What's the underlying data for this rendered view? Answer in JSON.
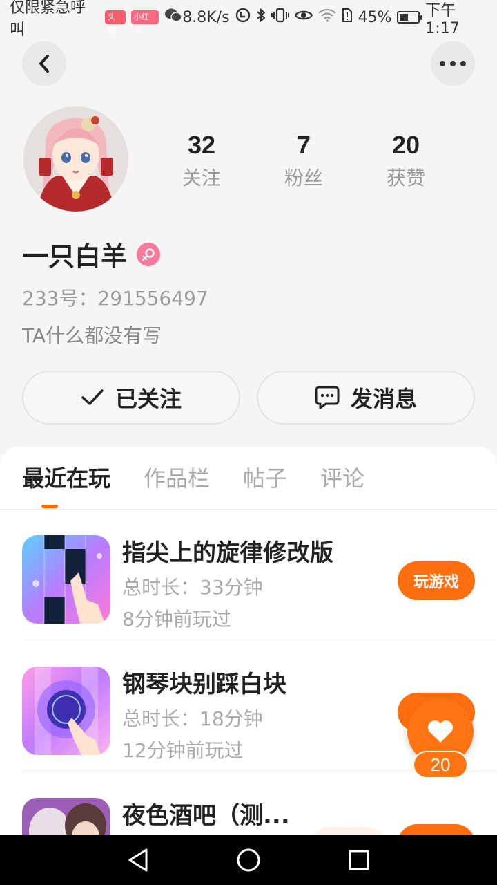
{
  "status_bar": {
    "left_text": "仅限紧急呼叫",
    "badge1": "头条",
    "badge2": "小红书",
    "speed": "8.8K/s",
    "battery": "45%",
    "battery_level": 0.45,
    "time": "下午1:17"
  },
  "profile": {
    "name": "一只白羊",
    "uid": "233号：291556497",
    "bio": "TA什么都没有写",
    "stats": [
      {
        "value": "32",
        "label": "关注"
      },
      {
        "value": "7",
        "label": "粉丝"
      },
      {
        "value": "20",
        "label": "获赞"
      }
    ]
  },
  "actions": {
    "follow_label": "已关注",
    "message_label": "发消息"
  },
  "tabs": [
    {
      "label": "最近在玩"
    },
    {
      "label": "作品栏"
    },
    {
      "label": "帖子"
    },
    {
      "label": "评论"
    }
  ],
  "games": [
    {
      "title": "指尖上的旋律修改版",
      "duration": "总时长：33分钟",
      "last_played": "8分钟前玩过",
      "button": "玩游戏"
    },
    {
      "title": "钢琴块别踩白块",
      "duration": "总时长：18分钟",
      "last_played": "12分钟前玩过",
      "button": ""
    },
    {
      "title": "夜色酒吧（测...",
      "duration": "",
      "last_played": "",
      "button": ""
    }
  ],
  "floating_like": {
    "count": "20"
  },
  "colors": {
    "accent": "#ff6f0f",
    "gender": "#f77a9c"
  },
  "icons": {
    "back": "chevron-left-icon",
    "more": "more-dots-icon",
    "check": "check-icon",
    "message": "chat-bubble-icon",
    "gender": "female-icon",
    "like": "heart-icon"
  }
}
